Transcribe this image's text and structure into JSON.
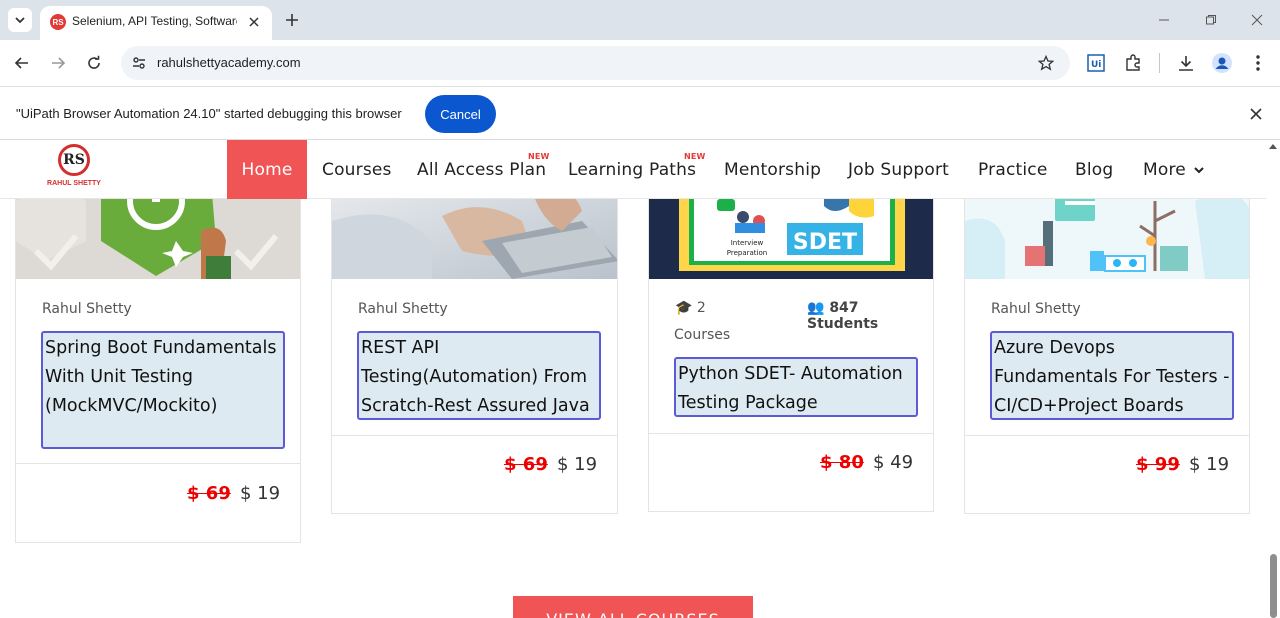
{
  "browser": {
    "tab_title": "Selenium, API Testing, Software",
    "url": "rahulshettyacademy.com",
    "infobar_message": "\"UiPath Browser Automation 24.10\" started debugging this browser",
    "infobar_cancel": "Cancel"
  },
  "site": {
    "logo_initials": "RS",
    "logo_name": "RAHUL SHETTY",
    "nav": [
      {
        "label": "Home",
        "active": true
      },
      {
        "label": "Courses"
      },
      {
        "label": "All Access Plan",
        "badge": "NEW"
      },
      {
        "label": "Learning Paths",
        "badge": "NEW"
      },
      {
        "label": "Mentorship"
      },
      {
        "label": "Job Support"
      },
      {
        "label": "Practice"
      },
      {
        "label": "Blog"
      },
      {
        "label": "More"
      }
    ]
  },
  "courses": [
    {
      "author": "Rahul Shetty",
      "title": "Spring Boot Fundamentals With Unit Testing (MockMVC/Mockito)",
      "old_price": "$ 69",
      "new_price": "$ 19"
    },
    {
      "author": "Rahul Shetty",
      "title": "REST API Testing(Automation) From Scratch-Rest Assured Java",
      "old_price": "$ 69",
      "new_price": "$ 19"
    },
    {
      "courses_count": "2",
      "courses_label": "Courses",
      "students": "847 Students",
      "title": "Python SDET- Automation Testing Package",
      "old_price": "$ 80",
      "new_price": "$ 49",
      "thumb_labels": [
        "Interview Preparation",
        "SDET"
      ]
    },
    {
      "author": "Rahul Shetty",
      "title": "Azure Devops Fundamentals For Testers -CI/CD+Project Boards",
      "old_price": "$ 99",
      "new_price": "$ 19"
    }
  ],
  "view_all_label": "VIEW ALL COURSES"
}
